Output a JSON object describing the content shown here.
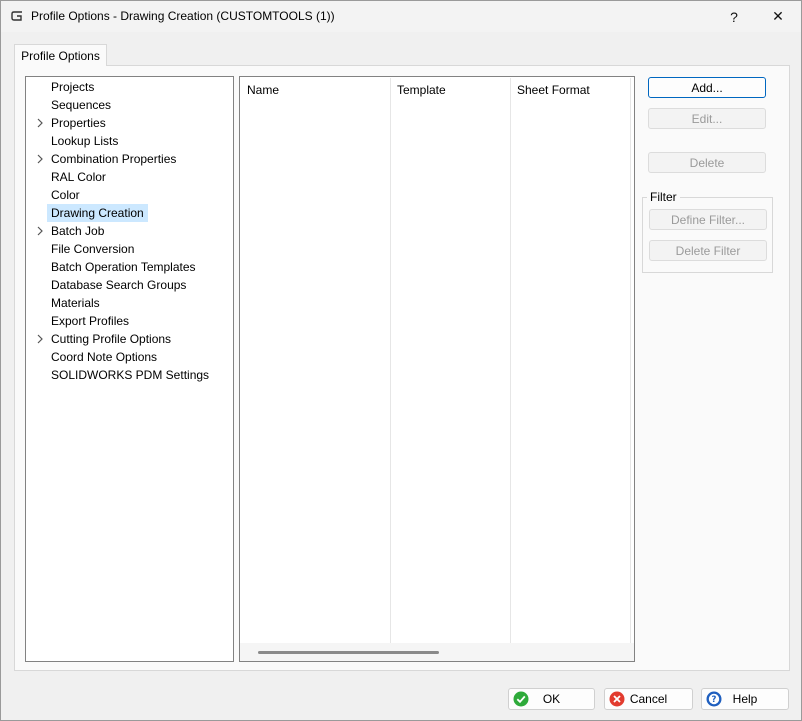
{
  "window": {
    "title": "Profile Options - Drawing Creation (CUSTOMTOOLS (1))",
    "help_glyph": "?",
    "close_glyph": "✕"
  },
  "tab": {
    "label": "Profile Options"
  },
  "tree": {
    "items": [
      {
        "label": "Projects",
        "expandable": false
      },
      {
        "label": "Sequences",
        "expandable": false
      },
      {
        "label": "Properties",
        "expandable": true
      },
      {
        "label": "Lookup Lists",
        "expandable": false
      },
      {
        "label": "Combination Properties",
        "expandable": true
      },
      {
        "label": "RAL Color",
        "expandable": false
      },
      {
        "label": "Color",
        "expandable": false
      },
      {
        "label": "Drawing Creation",
        "expandable": false,
        "selected": true
      },
      {
        "label": "Batch Job",
        "expandable": true
      },
      {
        "label": "File Conversion",
        "expandable": false
      },
      {
        "label": "Batch Operation Templates",
        "expandable": false
      },
      {
        "label": "Database Search Groups",
        "expandable": false
      },
      {
        "label": "Materials",
        "expandable": false
      },
      {
        "label": "Export Profiles",
        "expandable": false
      },
      {
        "label": "Cutting Profile Options",
        "expandable": true
      },
      {
        "label": "Coord Note Options",
        "expandable": false
      },
      {
        "label": "SOLIDWORKS PDM Settings",
        "expandable": false
      }
    ]
  },
  "grid": {
    "columns": [
      "Name",
      "Template",
      "Sheet Format"
    ]
  },
  "side_buttons": {
    "add": "Add...",
    "edit": "Edit...",
    "delete": "Delete"
  },
  "filter": {
    "legend": "Filter",
    "define": "Define Filter...",
    "delete": "Delete Filter"
  },
  "footer": {
    "ok": "OK",
    "cancel": "Cancel",
    "help": "Help"
  },
  "colors": {
    "selection": "#cce8ff",
    "default_border": "#0067c0",
    "ok_green": "#2eaa3a",
    "cancel_red": "#e23b2e",
    "help_blue": "#1f5fbf"
  },
  "icons": {
    "app": "custom-tools-icon",
    "expand": "chevron-right-icon",
    "ok": "check-circle-icon",
    "cancel": "x-circle-icon",
    "help": "question-circle-icon"
  }
}
